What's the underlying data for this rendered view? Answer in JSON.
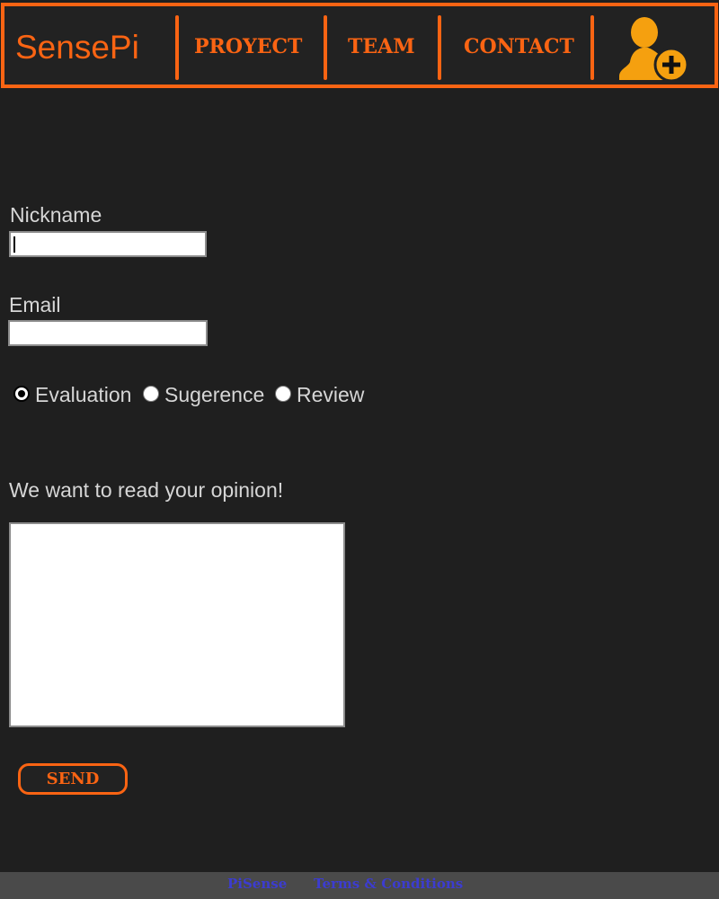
{
  "header": {
    "brand": "SensePi",
    "nav": {
      "proyect": "PROYECT",
      "team": "TEAM",
      "contact": "CONTACT"
    },
    "user_icon": "add-user-icon"
  },
  "form": {
    "nickname_label": "Nickname",
    "nickname_value": "",
    "email_label": "Email",
    "email_value": "",
    "options": {
      "evaluation": "Evaluation",
      "sugerence": "Sugerence",
      "review": "Review"
    },
    "selected_option": "Evaluation",
    "opinion_prompt": "We want to read your opinion!",
    "opinion_value": "",
    "send_label": "SEND"
  },
  "footer": {
    "brand_link": "PiSense",
    "terms_link": "Terms & Conditions"
  },
  "colors": {
    "accent": "#fa6413",
    "user_icon": "#f5a00f",
    "background": "#1f1f1f",
    "footer_bg": "#4a4a4a",
    "footer_link": "#3c3cd0"
  }
}
